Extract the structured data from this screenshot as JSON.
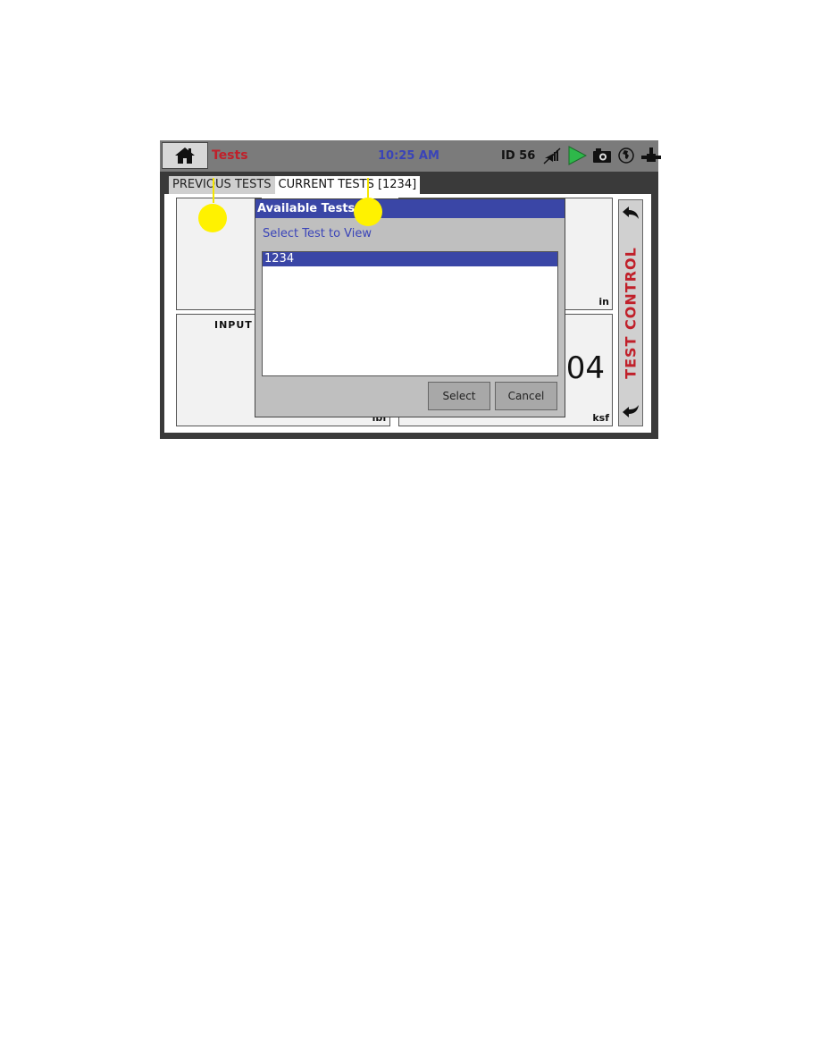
{
  "header": {
    "title": "Tests",
    "time": "10:25 AM",
    "id_label": "ID 56",
    "icons": [
      "home-icon",
      "mute-icon",
      "play-icon",
      "camera-icon",
      "globe-icon",
      "network-icon"
    ]
  },
  "tabs": [
    {
      "label": "PREVIOUS TESTS",
      "active": false
    },
    {
      "label": "CURRENT TESTS [1234]",
      "active": true
    }
  ],
  "panels": {
    "top_right_unit": "in",
    "bottom_left_label": "INPUT",
    "bottom_left_unit": "lbf",
    "bottom_right_value": "04",
    "bottom_right_unit": "ksf"
  },
  "side_control": {
    "label": "TEST CONTROL",
    "icons": [
      "back-arrow-icon",
      "forward-arrow-icon"
    ]
  },
  "dialog": {
    "title": "Available Tests",
    "subtitle": "Select Test to View",
    "items": [
      "1234"
    ],
    "selected_index": 0,
    "select_label": "Select",
    "cancel_label": "Cancel"
  },
  "colors": {
    "title_red": "#c0202a",
    "clock_blue": "#3a44b8",
    "dialog_blue": "#3a46a6",
    "play_green": "#2eb84a",
    "callout_yellow": "#fff200"
  }
}
